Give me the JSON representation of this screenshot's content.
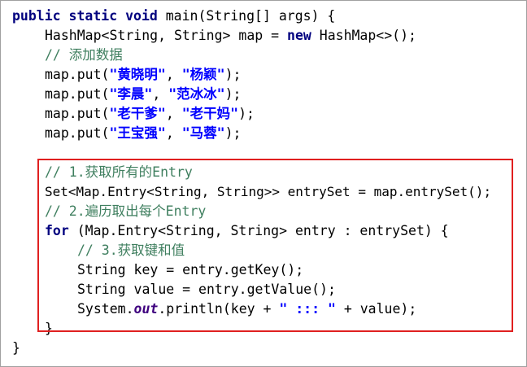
{
  "code": {
    "line1": {
      "kw": "public static void",
      "rest": " main(String[] args) {"
    },
    "line2": {
      "a": "HashMap<String, String> map = ",
      "kw": "new",
      "b": " HashMap<>();"
    },
    "line3": {
      "comment": "// 添加数据"
    },
    "line4": {
      "a": "map.put(",
      "s1": "\"黄晓明\"",
      "c": ", ",
      "s2": "\"杨颖\"",
      "d": ");"
    },
    "line5": {
      "a": "map.put(",
      "s1": "\"李晨\"",
      "c": ", ",
      "s2": "\"范冰冰\"",
      "d": ");"
    },
    "line6": {
      "a": "map.put(",
      "s1": "\"老干爹\"",
      "c": ", ",
      "s2": "\"老干妈\"",
      "d": ");"
    },
    "line7": {
      "a": "map.put(",
      "s1": "\"王宝强\"",
      "c": ", ",
      "s2": "\"马蓉\"",
      "d": ");"
    },
    "line9": {
      "comment": "// 1.获取所有的Entry"
    },
    "line10": {
      "text": "Set<Map.Entry<String, String>> entrySet = map.entrySet();"
    },
    "line11": {
      "comment": "// 2.遍历取出每个Entry"
    },
    "line12": {
      "kw": "for",
      "rest": " (Map.Entry<String, String> entry : entrySet) {"
    },
    "line13": {
      "comment": "// 3.获取键和值"
    },
    "line14": {
      "text": "String key = entry.getKey();"
    },
    "line15": {
      "text": "String value = entry.getValue();"
    },
    "line16": {
      "a": "System.",
      "field": "out",
      "b": ".println(key + ",
      "s": "\" ::: \"",
      "c": " + value);"
    },
    "line17": {
      "text": "}"
    },
    "line18": {
      "text": "}"
    }
  },
  "colors": {
    "keyword": "#00007f",
    "comment": "#3f7f5f",
    "string": "#0000ff",
    "static_field": "#3f007f",
    "highlight_border": "#e02020"
  }
}
